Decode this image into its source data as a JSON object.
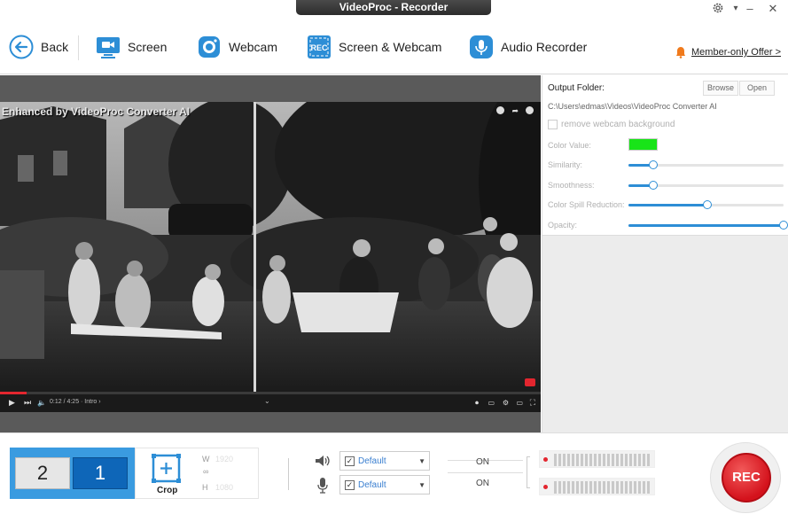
{
  "window": {
    "title": "VideoProc - Recorder",
    "settings_icon": "gear-icon",
    "minimize": "–",
    "close": "✕"
  },
  "toolbar": {
    "back": "Back",
    "screen": "Screen",
    "webcam": "Webcam",
    "screen_webcam": "Screen & Webcam",
    "audio": "Audio Recorder",
    "offer": "Member-only Offer >"
  },
  "video": {
    "title": "Enhanced by VideoProc Converter AI",
    "time": "0:12 / 4:25 · Intro ›",
    "colors": {
      "scene_dark": "#1a1a1a",
      "scene_light": "#8a8a8a"
    }
  },
  "panel": {
    "output_label": "Output Folder:",
    "browse": "Browse",
    "open": "Open",
    "path": "C:\\Users\\edmas\\Videos\\VideoProc Converter AI",
    "remove_bg": "remove webcam background",
    "color_value": "Color Value:",
    "similarity": "Similarity:",
    "smoothness": "Smoothness:",
    "spill": "Color Spill Reduction:",
    "opacity": "Opacity:",
    "colors": {
      "color_swatch": "#18e418",
      "accent": "#2d8ed6"
    },
    "levels": {
      "similarity": 0.16,
      "smoothness": 0.16,
      "spill": 0.51,
      "opacity": 1.0
    }
  },
  "bottom": {
    "layout_a": "2",
    "layout_b": "1",
    "crop": "Crop",
    "w_label": "W",
    "h_label": "H",
    "w_val": "1920",
    "h_val": "1080",
    "speaker_select": "Default",
    "mic_select": "Default",
    "speaker_on": "ON",
    "mic_on": "ON",
    "rec": "REC"
  }
}
